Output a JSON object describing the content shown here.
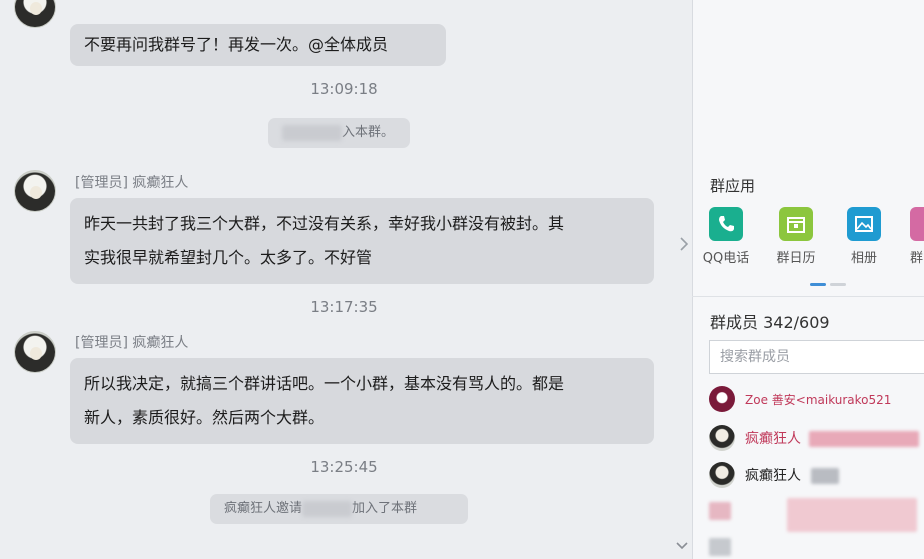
{
  "chat": {
    "messages": [
      {
        "sender": "[管理员] 疯癫狂人",
        "text": "不要再问我群号了！再发一次。@全体成员"
      },
      {
        "time": "13:09:18"
      },
      {
        "sys_suffix": "入本群。"
      },
      {
        "sender": "[管理员] 疯癫狂人",
        "line1": "昨天一共封了我三个大群，不过没有关系，幸好我小群没有被封。其",
        "line2": "实我很早就希望封几个。太多了。不好管"
      },
      {
        "time": "13:17:35"
      },
      {
        "sender": "[管理员] 疯癫狂人",
        "line1": "所以我决定，就搞三个群讲话吧。一个小群，基本没有骂人的。都是",
        "line2": "新人，素质很好。然后两个大群。"
      },
      {
        "time": "13:25:45"
      },
      {
        "sys_prefix": "疯癫狂人邀请",
        "sys_suffix": "加入了本群"
      }
    ]
  },
  "sidebar": {
    "apps_title": "群应用",
    "apps": [
      {
        "label": "QQ电话",
        "icon": "phone-icon",
        "color": "#1aaf8f"
      },
      {
        "label": "群日历",
        "icon": "calendar-icon",
        "color": "#8cc63e"
      },
      {
        "label": "相册",
        "icon": "album-icon",
        "color": "#1f9bd1"
      },
      {
        "label": "群",
        "icon": "more-app-icon",
        "color": "#d46aa3"
      }
    ],
    "members_title": "群成员 342/609",
    "search_placeholder": "搜索群成员",
    "members": [
      {
        "name": "Zoe 善安<maikurako521",
        "color": "#c0395a"
      },
      {
        "name": "疯癫狂人",
        "color": "#c0395a"
      },
      {
        "name": "疯癫狂人",
        "color": "#222222"
      }
    ]
  }
}
